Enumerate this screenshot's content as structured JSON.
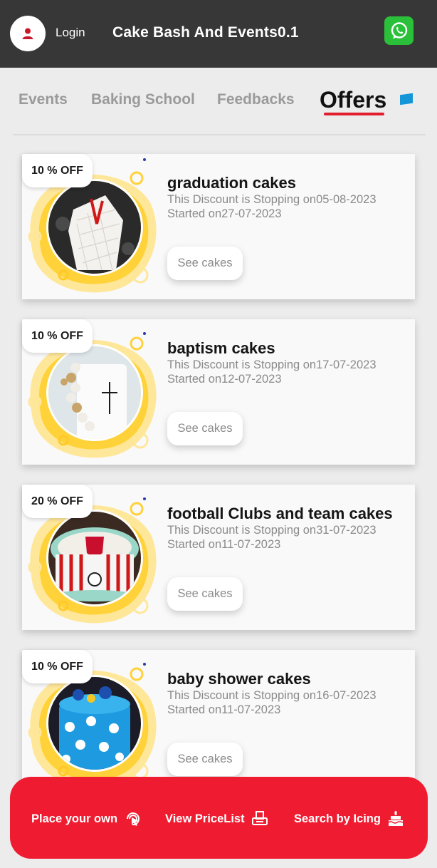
{
  "header": {
    "login_label": "Login",
    "app_title": "Cake Bash And Events0.1",
    "whatsapp_color": "#2bc03a"
  },
  "tabs": [
    {
      "label": "Events",
      "active": false
    },
    {
      "label": "Baking School",
      "active": false
    },
    {
      "label": "Feedbacks",
      "active": false
    },
    {
      "label": "Offers",
      "active": true
    }
  ],
  "offers": [
    {
      "discount": "10 % OFF",
      "title": "graduation cakes",
      "stopping": "This Discount is Stopping on05-08-2023",
      "started": "Started on27-07-2023",
      "button": "See cakes",
      "image": "quilted-white-cake"
    },
    {
      "discount": "10 % OFF",
      "title": "baptism cakes",
      "stopping": "This Discount is Stopping on17-07-2023",
      "started": "Started on12-07-2023",
      "button": "See cakes",
      "image": "pearl-cross-cake"
    },
    {
      "discount": "20 % OFF",
      "title": "football Clubs and team cakes",
      "stopping": "This Discount is Stopping on31-07-2023",
      "started": "Started on11-07-2023",
      "button": "See cakes",
      "image": "football-club-cake"
    },
    {
      "discount": "10 % OFF",
      "title": "baby shower cakes",
      "stopping": "This Discount is Stopping on16-07-2023",
      "started": "Started on11-07-2023",
      "button": "See cakes",
      "image": "blue-polka-cake"
    }
  ],
  "bottom_bar": {
    "place_own": "Place your own",
    "price_list": "View PriceList",
    "search_icing": "Search by Icing",
    "color": "#ef1c31"
  }
}
